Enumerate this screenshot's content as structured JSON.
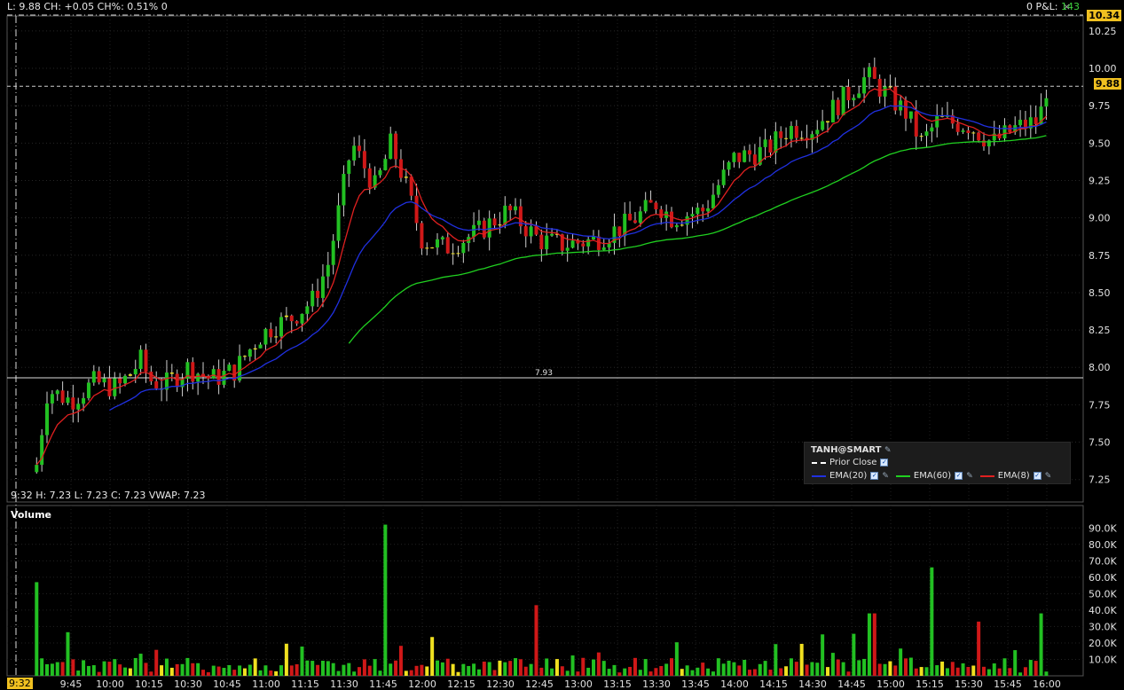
{
  "header": {
    "quote_text": "L: 9.88 CH: +0.05 CH%: 0.51% 0",
    "pnl_label": "0 P&L:",
    "pnl_value": "143",
    "close_glyph": "×",
    "last_price_badge": "10.34",
    "current_price_badge": "9.88"
  },
  "hover": {
    "text": "9:32   H: 7.23 L: 7.23 C: 7.23 VWAP: 7.23",
    "time_badge": "9:32"
  },
  "volume_panel": {
    "label": "Volume"
  },
  "legend": {
    "title": "TANH@SMART",
    "items": [
      {
        "label": "Prior Close",
        "color": "#ffffff",
        "style": "dashed"
      },
      {
        "label": "EMA(20)",
        "color": "#2030e0"
      },
      {
        "label": "EMA(60)",
        "color": "#20d020"
      },
      {
        "label": "EMA(8)",
        "color": "#e02020"
      }
    ]
  },
  "chart_data": {
    "type": "candlestick",
    "symbol": "TANH@SMART",
    "prior_close": 7.93,
    "prior_close_label": "7.93",
    "price_axis": {
      "min": 7.1,
      "max": 10.35,
      "ticks": [
        "10.25",
        "10.00",
        "9.75",
        "9.50",
        "9.25",
        "9.00",
        "8.75",
        "8.50",
        "8.25",
        "8.00",
        "7.75",
        "7.50",
        "7.25"
      ]
    },
    "volume_axis": {
      "max": 95000,
      "ticks": [
        "90.0K",
        "80.0K",
        "70.0K",
        "60.0K",
        "50.0K",
        "40.0K",
        "30.0K",
        "20.0K",
        "10.0K"
      ]
    },
    "time_axis": [
      "9:45",
      "10:00",
      "10:15",
      "10:30",
      "10:45",
      "11:00",
      "11:15",
      "11:30",
      "11:45",
      "12:00",
      "12:15",
      "12:30",
      "12:45",
      "13:00",
      "13:15",
      "13:30",
      "13:45",
      "14:00",
      "14:15",
      "14:30",
      "14:45",
      "15:00",
      "15:15",
      "15:30",
      "15:45",
      "16:00"
    ],
    "colors": {
      "up": "#22c022",
      "down": "#d01818",
      "neutral": "#f0e020",
      "ema8": "#e02020",
      "ema20": "#2030e0",
      "ema60": "#20d020",
      "grid": "#1e2a1e"
    },
    "price_path": [
      [
        9.53,
        7.35
      ],
      [
        9.6,
        7.85
      ],
      [
        9.75,
        7.78
      ],
      [
        9.9,
        7.9
      ],
      [
        10.05,
        7.86
      ],
      [
        10.2,
        8.05
      ],
      [
        10.25,
        7.92
      ],
      [
        10.35,
        7.88
      ],
      [
        10.5,
        8.0
      ],
      [
        10.65,
        7.92
      ],
      [
        10.8,
        7.98
      ],
      [
        10.95,
        8.2
      ],
      [
        11.05,
        8.28
      ],
      [
        11.15,
        8.32
      ],
      [
        11.3,
        8.45
      ],
      [
        11.4,
        8.7
      ],
      [
        11.55,
        9.5
      ],
      [
        11.7,
        9.2
      ],
      [
        11.8,
        9.5
      ],
      [
        11.9,
        9.2
      ],
      [
        12.0,
        8.85
      ],
      [
        12.15,
        8.8
      ],
      [
        12.35,
        8.9
      ],
      [
        12.55,
        9.05
      ],
      [
        12.75,
        8.85
      ],
      [
        12.9,
        8.82
      ],
      [
        13.1,
        8.85
      ],
      [
        13.3,
        8.95
      ],
      [
        13.5,
        9.1
      ],
      [
        13.6,
        9.0
      ],
      [
        13.8,
        9.05
      ],
      [
        14.0,
        9.4
      ],
      [
        14.2,
        9.45
      ],
      [
        14.35,
        9.6
      ],
      [
        14.5,
        9.6
      ],
      [
        14.65,
        9.75
      ],
      [
        14.85,
        9.95
      ],
      [
        15.0,
        9.8
      ],
      [
        15.1,
        9.7
      ],
      [
        15.2,
        9.5
      ],
      [
        15.3,
        9.65
      ],
      [
        15.5,
        9.62
      ],
      [
        15.65,
        9.5
      ],
      [
        15.8,
        9.6
      ],
      [
        15.95,
        9.65
      ],
      [
        16.0,
        9.88
      ]
    ],
    "volume_spikes": [
      [
        9.52,
        57000
      ],
      [
        11.75,
        92000
      ],
      [
        12.72,
        43000
      ],
      [
        14.88,
        38000
      ],
      [
        15.25,
        66000
      ],
      [
        15.95,
        38000
      ],
      [
        15.57,
        33000
      ]
    ]
  }
}
